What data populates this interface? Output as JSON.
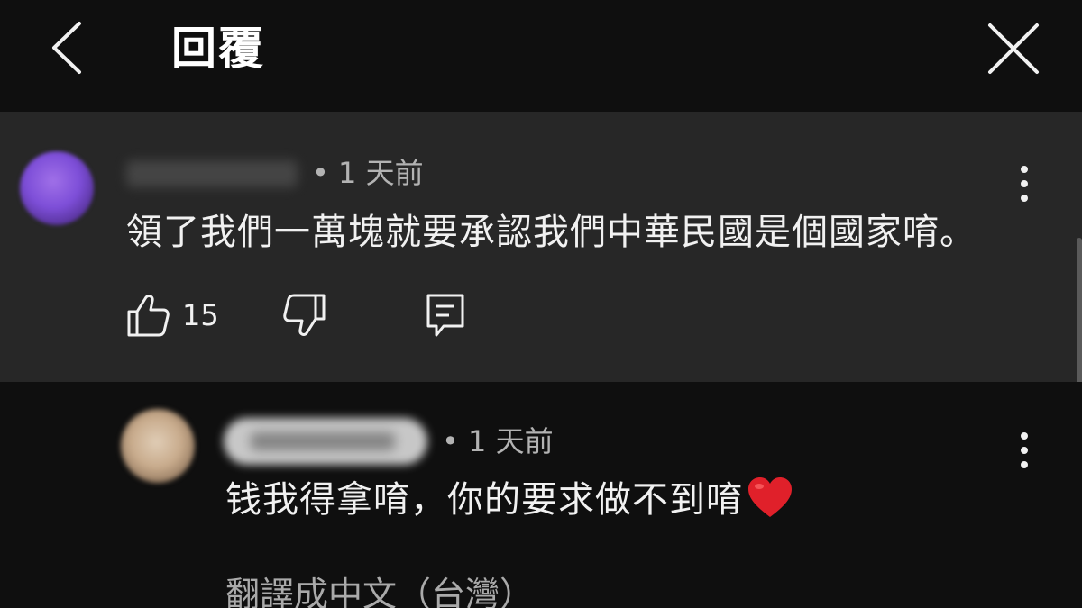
{
  "header": {
    "title": "回覆",
    "back_icon": "chevron-left-icon",
    "close_icon": "close-icon"
  },
  "parent_comment": {
    "timestamp": "• 1 天前",
    "text": "領了我們一萬塊就要承認我們中華民國是個國家唷。",
    "like_count": "15",
    "icons": [
      "thumb-up-icon",
      "thumb-down-icon",
      "reply-icon",
      "more-vert-icon"
    ]
  },
  "reply_comment": {
    "timestamp": "• 1 天前",
    "text": "钱我得拿唷，你的要求做不到唷",
    "translate_label": "翻譯成中文（台灣）",
    "icons": [
      "heart-emoji-icon",
      "more-vert-icon"
    ]
  },
  "colors": {
    "background": "#0f0f0f",
    "highlight_background": "#272727",
    "text_primary": "#f1f1f1",
    "text_secondary": "#b3b3b3",
    "heart": "#e0202a"
  }
}
